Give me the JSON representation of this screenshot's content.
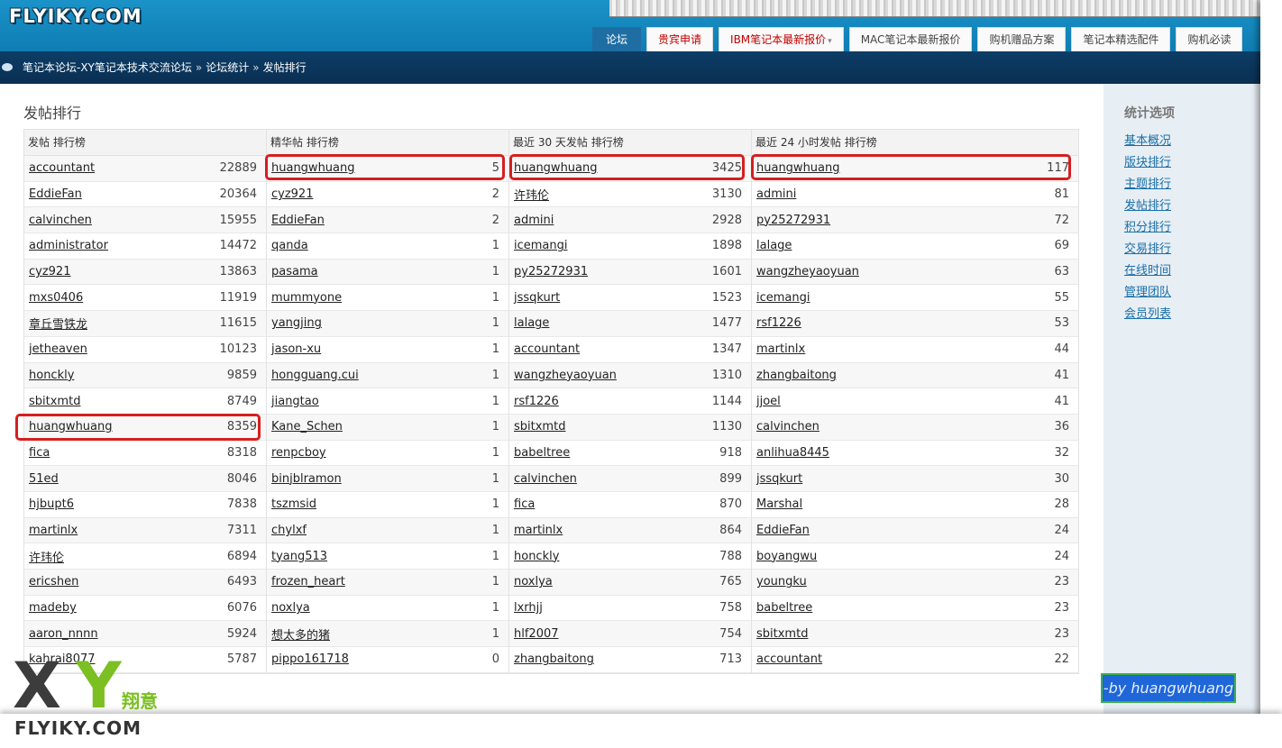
{
  "header": {
    "logo_text": "FLYIKY.COM",
    "tabs": [
      {
        "label": "论坛",
        "active": true
      },
      {
        "label": "贵宾申请",
        "color": "red"
      },
      {
        "label": "IBM笔记本最新报价",
        "color": "red",
        "dropdown": true
      },
      {
        "label": "MAC笔记本最新报价"
      },
      {
        "label": "购机赠品方案"
      },
      {
        "label": "笔记本精选配件"
      },
      {
        "label": "购机必读"
      }
    ]
  },
  "breadcrumb": {
    "items": [
      "笔记本论坛-XY笔记本技术交流论坛",
      "论坛统计",
      "发帖排行"
    ],
    "separator": "»"
  },
  "page": {
    "title": "发帖排行"
  },
  "tables": [
    {
      "header": "发帖 排行榜",
      "rows": [
        [
          "accountant",
          "22889"
        ],
        [
          "EddieFan",
          "20364"
        ],
        [
          "calvinchen",
          "15955"
        ],
        [
          "administrator",
          "14472"
        ],
        [
          "cyz921",
          "13863"
        ],
        [
          "mxs0406",
          "11919"
        ],
        [
          "章丘雪铁龙",
          "11615"
        ],
        [
          "jetheaven",
          "10123"
        ],
        [
          "honckly",
          "9859"
        ],
        [
          "sbitxmtd",
          "8749"
        ],
        [
          "huangwhuang",
          "8359"
        ],
        [
          "fica",
          "8318"
        ],
        [
          "51ed",
          "8046"
        ],
        [
          "hjbupt6",
          "7838"
        ],
        [
          "martinlx",
          "7311"
        ],
        [
          "许玮伦",
          "6894"
        ],
        [
          "ericshen",
          "6493"
        ],
        [
          "madeby",
          "6076"
        ],
        [
          "aaron_nnnn",
          "5924"
        ],
        [
          "kahrai8077",
          "5787"
        ]
      ]
    },
    {
      "header": "精华帖 排行榜",
      "rows": [
        [
          "huangwhuang",
          "5"
        ],
        [
          "cyz921",
          "2"
        ],
        [
          "EddieFan",
          "2"
        ],
        [
          "qanda",
          "1"
        ],
        [
          "pasama",
          "1"
        ],
        [
          "mummyone",
          "1"
        ],
        [
          "yangjing",
          "1"
        ],
        [
          "jason-xu",
          "1"
        ],
        [
          "hongguang.cui",
          "1"
        ],
        [
          "jiangtao",
          "1"
        ],
        [
          "Kane_Schen",
          "1"
        ],
        [
          "renpcboy",
          "1"
        ],
        [
          "binjblramon",
          "1"
        ],
        [
          "tszmsid",
          "1"
        ],
        [
          "chylxf",
          "1"
        ],
        [
          "tyang513",
          "1"
        ],
        [
          "frozen_heart",
          "1"
        ],
        [
          "noxlya",
          "1"
        ],
        [
          "想太多的猪",
          "1"
        ],
        [
          "pippo161718",
          "0"
        ]
      ]
    },
    {
      "header": "最近 30 天发帖 排行榜",
      "rows": [
        [
          "huangwhuang",
          "3425"
        ],
        [
          "许玮伦",
          "3130"
        ],
        [
          "admini",
          "2928"
        ],
        [
          "icemangi",
          "1898"
        ],
        [
          "py25272931",
          "1601"
        ],
        [
          "jssqkurt",
          "1523"
        ],
        [
          "lalage",
          "1477"
        ],
        [
          "accountant",
          "1347"
        ],
        [
          "wangzheyaoyuan",
          "1310"
        ],
        [
          "rsf1226",
          "1144"
        ],
        [
          "sbitxmtd",
          "1130"
        ],
        [
          "babeltree",
          "918"
        ],
        [
          "calvinchen",
          "899"
        ],
        [
          "fica",
          "870"
        ],
        [
          "martinlx",
          "864"
        ],
        [
          "honckly",
          "788"
        ],
        [
          "noxlya",
          "765"
        ],
        [
          "lxrhjj",
          "758"
        ],
        [
          "hlf2007",
          "754"
        ],
        [
          "zhangbaitong",
          "713"
        ]
      ]
    },
    {
      "header": "最近 24 小时发帖 排行榜",
      "rows": [
        [
          "huangwhuang",
          "117"
        ],
        [
          "admini",
          "81"
        ],
        [
          "py25272931",
          "72"
        ],
        [
          "lalage",
          "69"
        ],
        [
          "wangzheyaoyuan",
          "63"
        ],
        [
          "icemangi",
          "55"
        ],
        [
          "rsf1226",
          "53"
        ],
        [
          "martinlx",
          "44"
        ],
        [
          "zhangbaitong",
          "41"
        ],
        [
          "jjoel",
          "41"
        ],
        [
          "calvinchen",
          "36"
        ],
        [
          "anlihua8445",
          "32"
        ],
        [
          "jssqkurt",
          "30"
        ],
        [
          "Marshal",
          "28"
        ],
        [
          "EddieFan",
          "24"
        ],
        [
          "boyangwu",
          "24"
        ],
        [
          "youngku",
          "23"
        ],
        [
          "babeltree",
          "23"
        ],
        [
          "sbitxmtd",
          "23"
        ],
        [
          "accountant",
          "22"
        ]
      ]
    }
  ],
  "sidebar": {
    "title": "统计选项",
    "links": [
      "基本概况",
      "版块排行",
      "主题排行",
      "发帖排行",
      "积分排行",
      "交易排行",
      "在线时间",
      "管理团队",
      "会员列表"
    ]
  },
  "credit": "-by huangwhuang",
  "watermark": {
    "x": "X",
    "y": "Y",
    "cn": "翔意",
    "site": "FLYIKY.COM"
  },
  "colors": {
    "highlight": "#d41f1f",
    "header_blue": "#1a93c8",
    "breadcrumb_navy": "#0d3d66",
    "link": "#1a6fa8"
  }
}
